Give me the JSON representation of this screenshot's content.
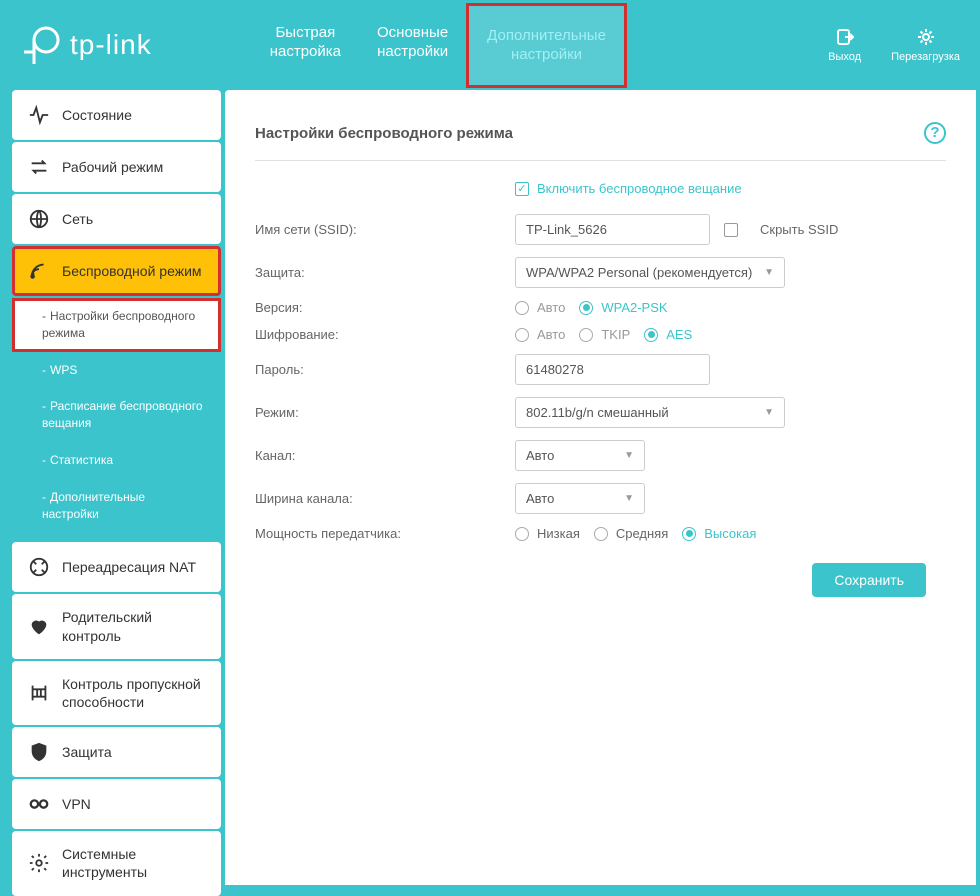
{
  "logo": "tp-link",
  "tabs": [
    {
      "line1": "Быстрая",
      "line2": "настройка"
    },
    {
      "line1": "Основные",
      "line2": "настройки"
    },
    {
      "line1": "Дополнительные",
      "line2": "настройки"
    }
  ],
  "header_actions": {
    "logout": "Выход",
    "reboot": "Перезагрузка"
  },
  "sidebar": {
    "status": "Состояние",
    "mode": "Рабочий режим",
    "network": "Сеть",
    "wireless": "Беспроводной режим",
    "nat": "Переадресация NAT",
    "parental": "Родительский контроль",
    "bandwidth": "Контроль пропускной способности",
    "security": "Защита",
    "vpn": "VPN",
    "system": "Системные инструменты",
    "sub": {
      "settings": "Настройки беспроводного режима",
      "wps": "WPS",
      "schedule": "Расписание беспроводного вещания",
      "stats": "Статистика",
      "advanced": "Дополнительные настройки"
    }
  },
  "content": {
    "title": "Настройки беспроводного режима",
    "enable_broadcast": "Включить беспроводное вещание",
    "ssid_label": "Имя сети (SSID):",
    "ssid_value": "TP-Link_5626",
    "hide_ssid": "Скрыть SSID",
    "security_label": "Защита:",
    "security_value": "WPA/WPA2 Personal (рекомендуется)",
    "version_label": "Версия:",
    "version_auto": "Авто",
    "version_wpa2": "WPA2-PSK",
    "encryption_label": "Шифрование:",
    "enc_auto": "Авто",
    "enc_tkip": "TKIP",
    "enc_aes": "AES",
    "password_label": "Пароль:",
    "password_value": "61480278",
    "mode_label": "Режим:",
    "mode_value": "802.11b/g/n смешанный",
    "channel_label": "Канал:",
    "channel_value": "Авто",
    "width_label": "Ширина канала:",
    "width_value": "Авто",
    "power_label": "Мощность передатчика:",
    "power_low": "Низкая",
    "power_med": "Средняя",
    "power_high": "Высокая",
    "save": "Сохранить"
  }
}
